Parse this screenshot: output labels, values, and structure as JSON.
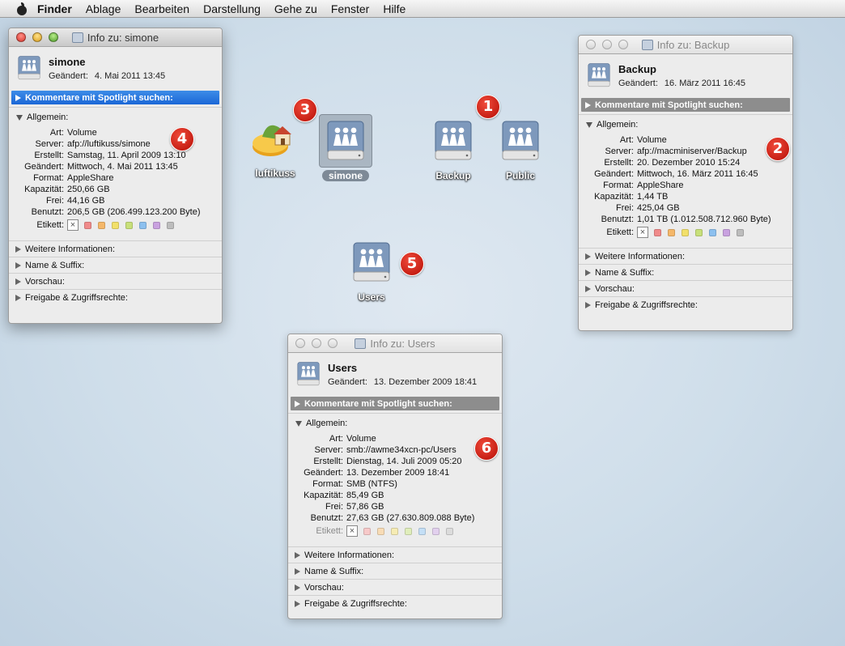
{
  "menubar": {
    "items": [
      "Finder",
      "Ablage",
      "Bearbeiten",
      "Darstellung",
      "Gehe zu",
      "Fenster",
      "Hilfe"
    ]
  },
  "desktop": {
    "icons": [
      {
        "label": "luftikuss",
        "icon": "shared-house-icon"
      },
      {
        "label": "simone",
        "icon": "network-volume-icon",
        "selected": true
      },
      {
        "label": "Backup",
        "icon": "network-volume-icon"
      },
      {
        "label": "Public",
        "icon": "network-volume-icon"
      },
      {
        "label": "Users",
        "icon": "network-volume-icon"
      }
    ],
    "badges": [
      "1",
      "2",
      "3",
      "4",
      "5",
      "6"
    ]
  },
  "windows": {
    "simone": {
      "title": "Info zu: simone",
      "name": "simone",
      "modified_label": "Geändert:",
      "modified": "4. Mai 2011 13:45",
      "spotlight": "Kommentare mit Spotlight suchen:",
      "general": "Allgemein:",
      "rows": [
        {
          "k": "Art:",
          "v": "Volume"
        },
        {
          "k": "Server:",
          "v": "afp://luftikuss/simone"
        },
        {
          "k": "Erstellt:",
          "v": "Samstag, 11. April 2009 13:10"
        },
        {
          "k": "Geändert:",
          "v": "Mittwoch, 4. Mai 2011 13:45"
        },
        {
          "k": "Format:",
          "v": "AppleShare"
        },
        {
          "k": "Kapazität:",
          "v": "250,66 GB"
        },
        {
          "k": "Frei:",
          "v": "44,16 GB"
        },
        {
          "k": "Benutzt:",
          "v": "206,5 GB (206.499.123.200 Byte)"
        }
      ],
      "label_key": "Etikett:",
      "sections": [
        "Weitere Informationen:",
        "Name & Suffix:",
        "Vorschau:",
        "Freigabe & Zugriffsrechte:"
      ]
    },
    "backup": {
      "title": "Info zu: Backup",
      "name": "Backup",
      "modified_label": "Geändert:",
      "modified": "16. März 2011 16:45",
      "spotlight": "Kommentare mit Spotlight suchen:",
      "general": "Allgemein:",
      "rows": [
        {
          "k": "Art:",
          "v": "Volume"
        },
        {
          "k": "Server:",
          "v": "afp://macminiserver/Backup"
        },
        {
          "k": "Erstellt:",
          "v": "20. Dezember 2010 15:24"
        },
        {
          "k": "Geändert:",
          "v": "Mittwoch, 16. März 2011 16:45"
        },
        {
          "k": "Format:",
          "v": "AppleShare"
        },
        {
          "k": "Kapazität:",
          "v": "1,44 TB"
        },
        {
          "k": "Frei:",
          "v": "425,04 GB"
        },
        {
          "k": "Benutzt:",
          "v": "1,01 TB (1.012.508.712.960 Byte)"
        }
      ],
      "label_key": "Etikett:",
      "sections": [
        "Weitere Informationen:",
        "Name & Suffix:",
        "Vorschau:",
        "Freigabe & Zugriffsrechte:"
      ]
    },
    "users": {
      "title": "Info zu: Users",
      "name": "Users",
      "modified_label": "Geändert:",
      "modified": "13. Dezember 2009 18:41",
      "spotlight": "Kommentare mit Spotlight suchen:",
      "general": "Allgemein:",
      "rows": [
        {
          "k": "Art:",
          "v": "Volume"
        },
        {
          "k": "Server:",
          "v": "smb://awme34xcn-pc/Users"
        },
        {
          "k": "Erstellt:",
          "v": "Dienstag, 14. Juli 2009 05:20"
        },
        {
          "k": "Geändert:",
          "v": "13. Dezember 2009 18:41"
        },
        {
          "k": "Format:",
          "v": "SMB (NTFS)"
        },
        {
          "k": "Kapazität:",
          "v": "85,49 GB"
        },
        {
          "k": "Frei:",
          "v": "57,86 GB"
        },
        {
          "k": "Benutzt:",
          "v": "27,63 GB (27.630.809.088 Byte)"
        }
      ],
      "label_key": "Etikett:",
      "sections": [
        "Weitere Informationen:",
        "Name & Suffix:",
        "Vorschau:",
        "Freigabe & Zugriffsrechte:"
      ]
    }
  },
  "label_colors": [
    "#f08a8a",
    "#f5b86a",
    "#f2e06a",
    "#c8e07a",
    "#8cc0ef",
    "#c9a2e0",
    "#bdbdbd"
  ]
}
